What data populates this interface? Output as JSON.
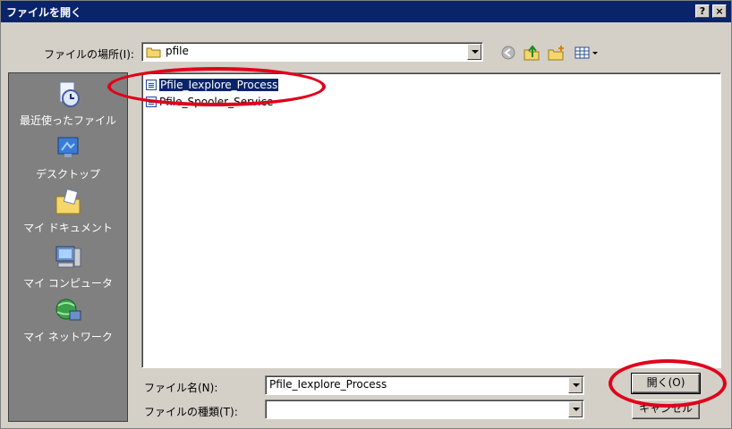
{
  "window": {
    "title": "ファイルを開く",
    "help_label": "?",
    "close_label": "×"
  },
  "location": {
    "label": "ファイルの場所(I):",
    "value": "pfile"
  },
  "places": [
    {
      "key": "recent",
      "label": "最近使ったファイル"
    },
    {
      "key": "desktop",
      "label": "デスクトップ"
    },
    {
      "key": "documents",
      "label": "マイ ドキュメント"
    },
    {
      "key": "computer",
      "label": "マイ コンピュータ"
    },
    {
      "key": "network",
      "label": "マイ ネットワーク"
    }
  ],
  "files": [
    {
      "name": "Pfile_Iexplore_Process",
      "selected": true
    },
    {
      "name": "Pfile_Spooler_Service",
      "selected": false
    }
  ],
  "filename": {
    "label": "ファイル名(N):",
    "value": "Pfile_Iexplore_Process"
  },
  "filetype": {
    "label": "ファイルの種類(T):",
    "value": ""
  },
  "buttons": {
    "open": "開く(O)",
    "cancel": "キャンセル"
  },
  "icons": [
    "back-icon",
    "up-folder-icon",
    "new-folder-icon",
    "view-menu-icon"
  ],
  "colors": {
    "titlebar": "#0a246a",
    "face": "#d4d0c8",
    "places_bar": "#808080",
    "highlight": "#0a246a",
    "annotation": "#e0001b"
  }
}
